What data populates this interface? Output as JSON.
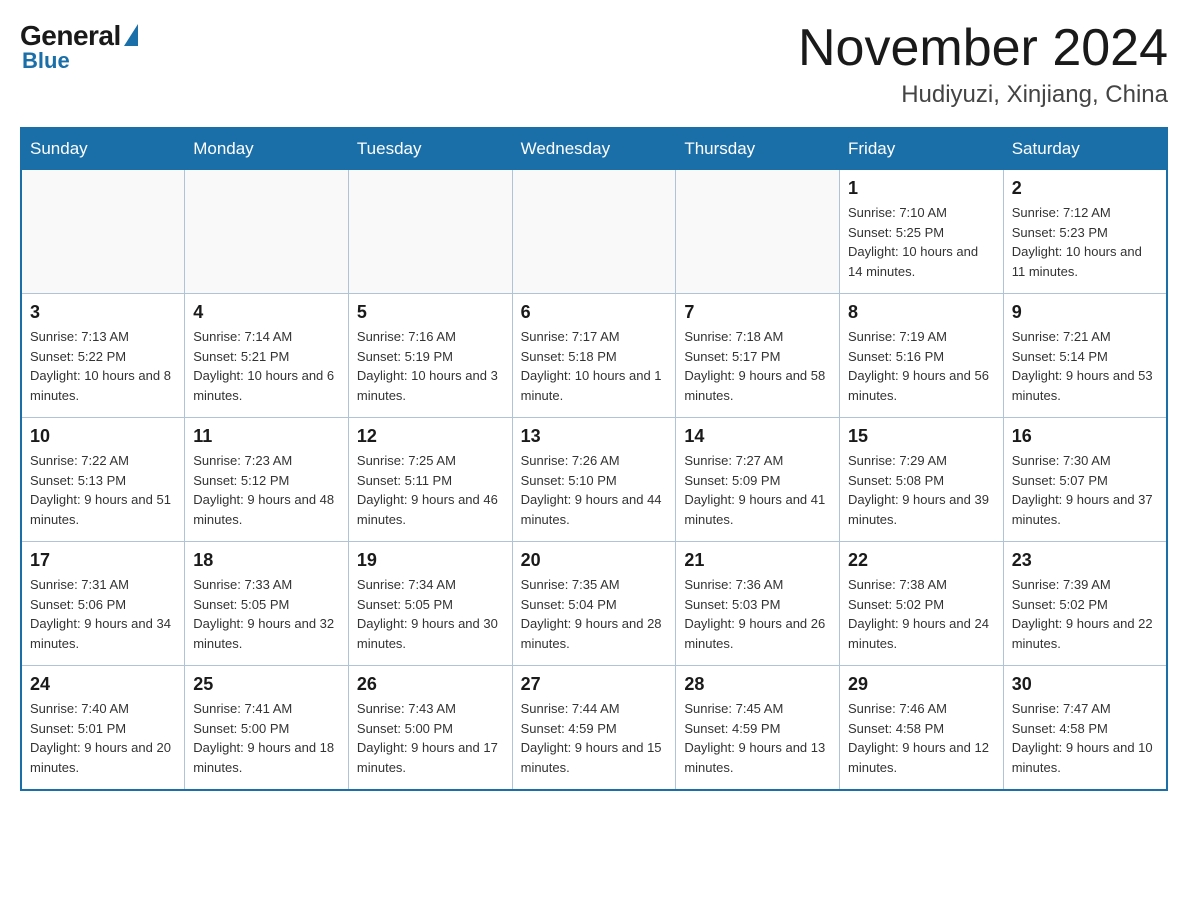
{
  "header": {
    "logo": {
      "general": "General",
      "blue": "Blue"
    },
    "title": "November 2024",
    "location": "Hudiyuzi, Xinjiang, China"
  },
  "weekdays": [
    "Sunday",
    "Monday",
    "Tuesday",
    "Wednesday",
    "Thursday",
    "Friday",
    "Saturday"
  ],
  "weeks": [
    [
      {
        "day": "",
        "info": ""
      },
      {
        "day": "",
        "info": ""
      },
      {
        "day": "",
        "info": ""
      },
      {
        "day": "",
        "info": ""
      },
      {
        "day": "",
        "info": ""
      },
      {
        "day": "1",
        "info": "Sunrise: 7:10 AM\nSunset: 5:25 PM\nDaylight: 10 hours and 14 minutes."
      },
      {
        "day": "2",
        "info": "Sunrise: 7:12 AM\nSunset: 5:23 PM\nDaylight: 10 hours and 11 minutes."
      }
    ],
    [
      {
        "day": "3",
        "info": "Sunrise: 7:13 AM\nSunset: 5:22 PM\nDaylight: 10 hours and 8 minutes."
      },
      {
        "day": "4",
        "info": "Sunrise: 7:14 AM\nSunset: 5:21 PM\nDaylight: 10 hours and 6 minutes."
      },
      {
        "day": "5",
        "info": "Sunrise: 7:16 AM\nSunset: 5:19 PM\nDaylight: 10 hours and 3 minutes."
      },
      {
        "day": "6",
        "info": "Sunrise: 7:17 AM\nSunset: 5:18 PM\nDaylight: 10 hours and 1 minute."
      },
      {
        "day": "7",
        "info": "Sunrise: 7:18 AM\nSunset: 5:17 PM\nDaylight: 9 hours and 58 minutes."
      },
      {
        "day": "8",
        "info": "Sunrise: 7:19 AM\nSunset: 5:16 PM\nDaylight: 9 hours and 56 minutes."
      },
      {
        "day": "9",
        "info": "Sunrise: 7:21 AM\nSunset: 5:14 PM\nDaylight: 9 hours and 53 minutes."
      }
    ],
    [
      {
        "day": "10",
        "info": "Sunrise: 7:22 AM\nSunset: 5:13 PM\nDaylight: 9 hours and 51 minutes."
      },
      {
        "day": "11",
        "info": "Sunrise: 7:23 AM\nSunset: 5:12 PM\nDaylight: 9 hours and 48 minutes."
      },
      {
        "day": "12",
        "info": "Sunrise: 7:25 AM\nSunset: 5:11 PM\nDaylight: 9 hours and 46 minutes."
      },
      {
        "day": "13",
        "info": "Sunrise: 7:26 AM\nSunset: 5:10 PM\nDaylight: 9 hours and 44 minutes."
      },
      {
        "day": "14",
        "info": "Sunrise: 7:27 AM\nSunset: 5:09 PM\nDaylight: 9 hours and 41 minutes."
      },
      {
        "day": "15",
        "info": "Sunrise: 7:29 AM\nSunset: 5:08 PM\nDaylight: 9 hours and 39 minutes."
      },
      {
        "day": "16",
        "info": "Sunrise: 7:30 AM\nSunset: 5:07 PM\nDaylight: 9 hours and 37 minutes."
      }
    ],
    [
      {
        "day": "17",
        "info": "Sunrise: 7:31 AM\nSunset: 5:06 PM\nDaylight: 9 hours and 34 minutes."
      },
      {
        "day": "18",
        "info": "Sunrise: 7:33 AM\nSunset: 5:05 PM\nDaylight: 9 hours and 32 minutes."
      },
      {
        "day": "19",
        "info": "Sunrise: 7:34 AM\nSunset: 5:05 PM\nDaylight: 9 hours and 30 minutes."
      },
      {
        "day": "20",
        "info": "Sunrise: 7:35 AM\nSunset: 5:04 PM\nDaylight: 9 hours and 28 minutes."
      },
      {
        "day": "21",
        "info": "Sunrise: 7:36 AM\nSunset: 5:03 PM\nDaylight: 9 hours and 26 minutes."
      },
      {
        "day": "22",
        "info": "Sunrise: 7:38 AM\nSunset: 5:02 PM\nDaylight: 9 hours and 24 minutes."
      },
      {
        "day": "23",
        "info": "Sunrise: 7:39 AM\nSunset: 5:02 PM\nDaylight: 9 hours and 22 minutes."
      }
    ],
    [
      {
        "day": "24",
        "info": "Sunrise: 7:40 AM\nSunset: 5:01 PM\nDaylight: 9 hours and 20 minutes."
      },
      {
        "day": "25",
        "info": "Sunrise: 7:41 AM\nSunset: 5:00 PM\nDaylight: 9 hours and 18 minutes."
      },
      {
        "day": "26",
        "info": "Sunrise: 7:43 AM\nSunset: 5:00 PM\nDaylight: 9 hours and 17 minutes."
      },
      {
        "day": "27",
        "info": "Sunrise: 7:44 AM\nSunset: 4:59 PM\nDaylight: 9 hours and 15 minutes."
      },
      {
        "day": "28",
        "info": "Sunrise: 7:45 AM\nSunset: 4:59 PM\nDaylight: 9 hours and 13 minutes."
      },
      {
        "day": "29",
        "info": "Sunrise: 7:46 AM\nSunset: 4:58 PM\nDaylight: 9 hours and 12 minutes."
      },
      {
        "day": "30",
        "info": "Sunrise: 7:47 AM\nSunset: 4:58 PM\nDaylight: 9 hours and 10 minutes."
      }
    ]
  ]
}
